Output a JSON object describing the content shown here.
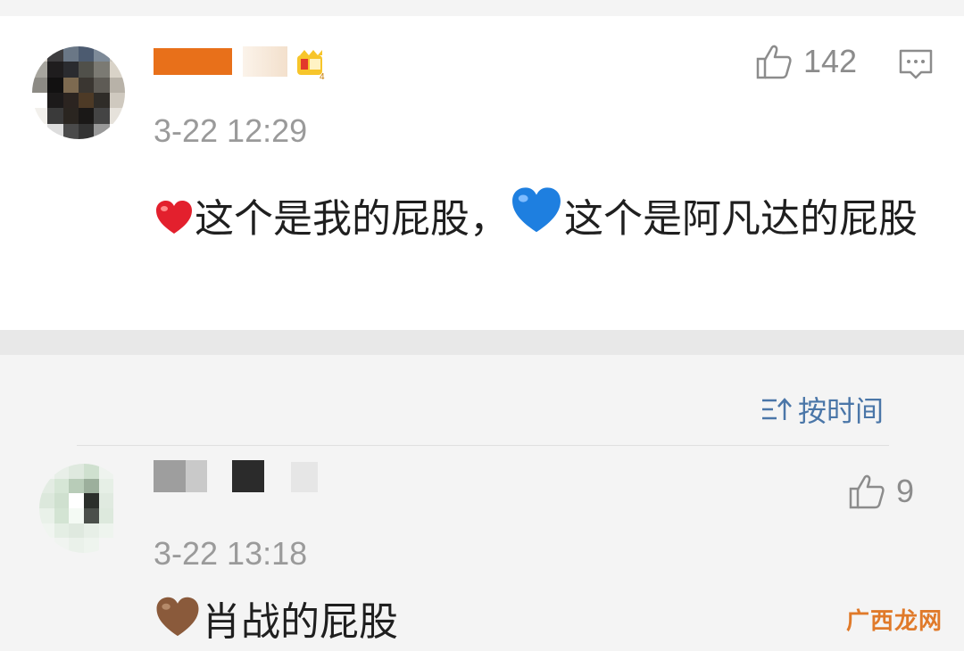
{
  "comment_main": {
    "time": "3-22 12:29",
    "likes": "142",
    "text_a": "这个是我的屁股，",
    "text_b": "这个是阿凡达的屁股"
  },
  "sort": {
    "label": "按时间"
  },
  "comment_reply": {
    "time": "3-22 13:18",
    "likes": "9",
    "text": "肖战的屁股"
  },
  "watermark": "广西龙网",
  "icons": [
    "thumbs-up-icon",
    "comment-icon",
    "sort-icon",
    "crown-badge-icon"
  ],
  "colors": {
    "link": "#4a76a8",
    "username": "#e8701a",
    "meta": "#9a9a9a"
  }
}
